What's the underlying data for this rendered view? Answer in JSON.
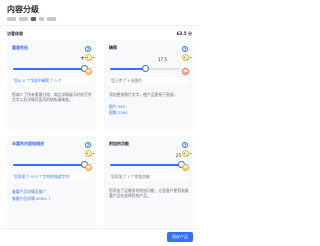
{
  "page": {
    "title": "内容分级"
  },
  "section": {
    "label": "访客体验",
    "score": "63.5 分"
  },
  "cards": [
    {
      "title": "重复性低",
      "slider_value": 1.0,
      "value_label": "+",
      "hint": "您从 0 个字段中精简了 0 个",
      "description": "您减少了所有需要分组、商品详情展示时的冗余文字以及详情页面页的结构清晰度。",
      "top_icon": "neutral-face-icon",
      "bottom_icon": "happy-face-icon"
    },
    {
      "title": "精简",
      "slider_value": 0.5,
      "value_label": "17.5",
      "hint": "您上传了 4 张图片",
      "description": "添加更多图片文字，使产品更易于直接。",
      "links": [
        "图片 383",
        "视频 2263"
      ],
      "top_icon": "neutral-face-icon",
      "bottom_icon": "sad-face-icon"
    },
    {
      "title": "丰富的内容和描述",
      "slider_value": 1.0,
      "value_label": "",
      "hint": "您添加了 973 个字符的描述字符",
      "description": "",
      "links": [
        "查看产品详情页推广",
        "查看产品详情 209% ↑"
      ],
      "top_icon": "neutral-face-icon",
      "bottom_icon": "happy-face-icon"
    },
    {
      "title": "附加的功能",
      "slider_value": 1.0,
      "value_label": "25",
      "hint": "您添加了 7 个附加功能",
      "description": "您添加了足够多的附加功能，让您客户更容易查看产品在选择您的产品。",
      "top_icon": "neutral-face-icon",
      "bottom_icon": "happy-face-icon"
    }
  ],
  "footer": {
    "save_label": "保存产品"
  }
}
